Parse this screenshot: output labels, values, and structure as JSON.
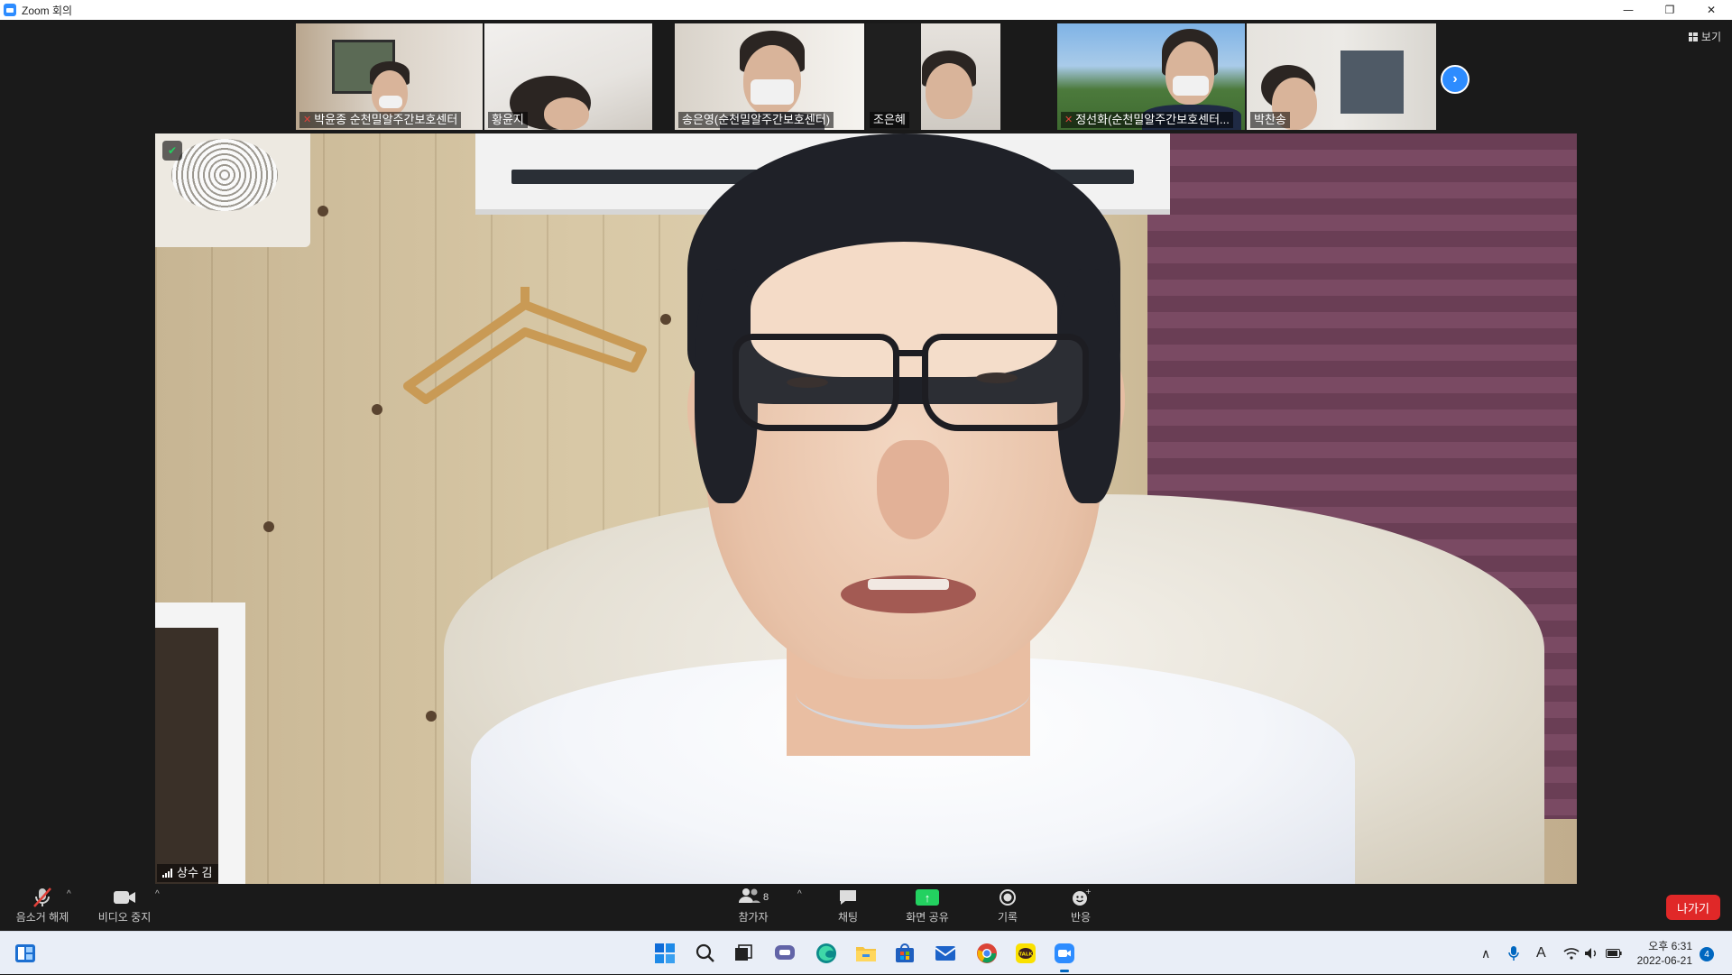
{
  "window": {
    "title": "Zoom 회의",
    "controls": {
      "minimize": "—",
      "restore": "❐",
      "close": "✕"
    }
  },
  "thumbnails": [
    {
      "name": "박윤종 순천밀알주간보호센터",
      "muted": true
    },
    {
      "name": "황윤지",
      "muted": false
    },
    {
      "name": "송은영(순천밀알주간보호센터)",
      "muted": false
    },
    {
      "name": "조은혜",
      "muted": false
    },
    {
      "name": "정선화(순천밀알주간보호센터...",
      "muted": true
    },
    {
      "name": "박찬송",
      "muted": false
    }
  ],
  "view_button": {
    "label": "보기"
  },
  "next_page_icon": "chevron-right-icon",
  "main_speaker": {
    "name": "상수 김",
    "encryption_icon": "shield-icon"
  },
  "toolbar": {
    "mute_label": "음소거 해제",
    "video_label": "비디오 중지",
    "participants_label": "참가자",
    "participants_count": "8",
    "chat_label": "채팅",
    "share_label": "화면 공유",
    "record_label": "기록",
    "reactions_label": "반응",
    "leave_label": "나가기"
  },
  "colors": {
    "accent": "#2D8CFF",
    "share_green": "#23D160",
    "leave_red": "#E02828",
    "muted_red": "#E0413A"
  },
  "taskbar": {
    "icons": [
      "widgets-icon",
      "start-icon",
      "search-icon",
      "task-view-icon",
      "teams-chat-icon",
      "edge-icon",
      "file-explorer-icon",
      "store-icon",
      "mail-icon",
      "chrome-icon",
      "kakaotalk-icon",
      "zoom-icon"
    ],
    "kakaotalk_text": "TALK",
    "ime_label": "A",
    "time": "오후 6:31",
    "date": "2022-06-21",
    "notification_count": "4"
  }
}
